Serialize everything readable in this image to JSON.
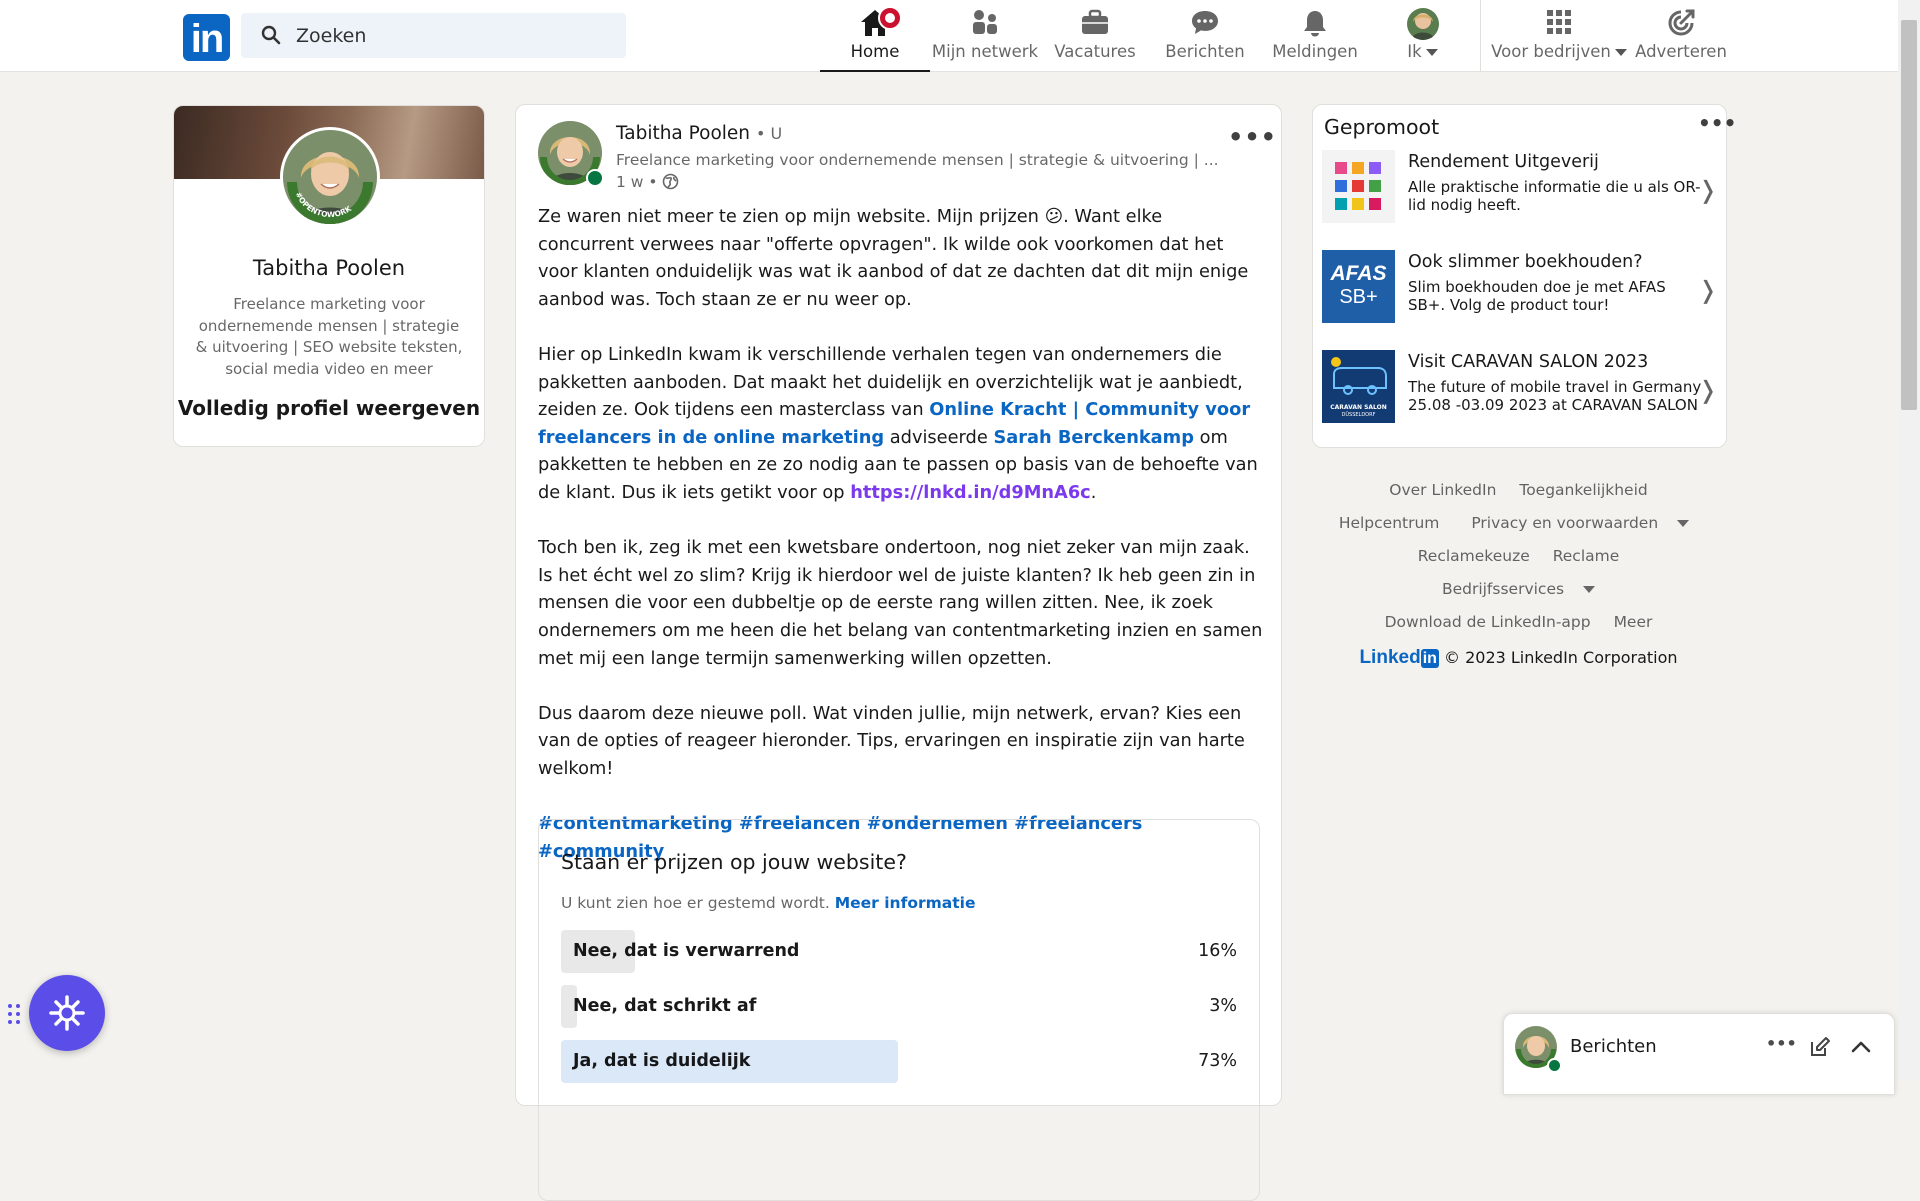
{
  "nav": {
    "search_placeholder": "Zoeken",
    "items": [
      {
        "label": "Home"
      },
      {
        "label": "Mijn netwerk"
      },
      {
        "label": "Vacatures"
      },
      {
        "label": "Berichten"
      },
      {
        "label": "Meldingen"
      },
      {
        "label": "Ik"
      },
      {
        "label": "Voor bedrijven"
      },
      {
        "label": "Adverteren"
      }
    ]
  },
  "profile": {
    "name": "Tabitha Poolen",
    "headline": "Freelance marketing voor ondernemende mensen | strategie & uitvoering | SEO website teksten, social media video en meer",
    "view_full": "Volledig profiel weergeven",
    "frame_text": "#OPENTOWORK"
  },
  "post": {
    "author": "Tabitha Poolen",
    "degree": "• U",
    "headline": "Freelance marketing voor ondernemende mensen | strategie & uitvoering | ...",
    "time": "1 w •",
    "p1": "Ze waren niet meer te zien op mijn website. Mijn prijzen 😕. Want elke concurrent verwees naar \"offerte opvragen\". Ik wilde ook voorkomen dat het voor klanten onduidelijk was wat ik aanbod of dat ze dachten dat dit mijn enige aanbod was. Toch staan ze er nu weer op.",
    "p2_a": "Hier op LinkedIn kwam ik verschillende verhalen tegen van ondernemers die pakketten aanboden. Dat maakt het duidelijk en overzichtelijk wat je aanbiedt, zeiden ze. Ook tijdens een masterclass van ",
    "p2_link1": "Online Kracht | Community voor freelancers in de online marketing",
    "p2_b": " adviseerde ",
    "p2_link2": "Sarah Berckenkamp",
    "p2_c": " om pakketten te hebben en ze zo nodig aan te passen op basis van de behoefte van de klant. Dus ik iets getikt voor op ",
    "p2_url": "https://lnkd.in/d9MnA6c",
    "p2_d": ".",
    "p3": "Toch ben ik, zeg ik met een kwetsbare ondertoon, nog niet zeker van mijn zaak. Is het écht wel zo slim? Krijg ik hierdoor wel de juiste klanten? Ik heb geen zin in mensen die voor een dubbeltje op de eerste rang willen zitten. Nee, ik zoek ondernemers om me heen die het belang van contentmarketing inzien en samen met mij een lange termijn samenwerking willen opzetten.",
    "p4": "Dus daarom deze nieuwe poll. Wat vinden jullie, mijn netwerk, ervan? Kies een van de opties of reageer hieronder. Tips, ervaringen en inspiratie zijn van harte welkom!",
    "hashtags": "#contentmarketing #freelancen #ondernemen #freelancers #community",
    "poll": {
      "question": "Staan er prijzen op jouw website?",
      "note": "U kunt zien hoe er gestemd wordt.",
      "more": "Meer informatie",
      "options": [
        {
          "text": "Nee, dat is verwarrend",
          "pct": "16%",
          "value": 0.16
        },
        {
          "text": "Nee, dat schrikt af",
          "pct": "3%",
          "value": 0.03
        },
        {
          "text": "Ja, dat is duidelijk",
          "pct": "73%",
          "value": 0.73
        }
      ]
    }
  },
  "promo": {
    "title": "Gepromoot",
    "ads": [
      {
        "title": "Rendement Uitgeverij",
        "desc": "Alle praktische informatie die u als OR-lid nodig heeft."
      },
      {
        "title": "Ook slimmer boekhouden?",
        "desc": "Slim boekhouden doe je met AFAS SB+. Volg de product tour!",
        "logo_a": "AFAS",
        "logo_b": "SB+"
      },
      {
        "title": "Visit CARAVAN SALON 2023",
        "desc": "The future of mobile travel in Germany 25.08 -03.09 2023 at CARAVAN SALON",
        "logo_a": "CARAVAN SALON",
        "logo_b": "DÜSSELDORF"
      }
    ]
  },
  "footer": {
    "links": [
      "Over LinkedIn",
      "Toegankelijkheid",
      "Helpcentrum",
      "Privacy en voorwaarden",
      "Reclamekeuze",
      "Reclame",
      "Bedrijfsservices",
      "Download de LinkedIn-app",
      "Meer"
    ],
    "brand_a": "Linked",
    "brand_b": "in",
    "copyright": "© 2023 LinkedIn Corporation"
  },
  "messaging": {
    "title": "Berichten"
  },
  "colors": {
    "brand": "#0a66c2",
    "poll_leader": "#dbe8f8",
    "poll_other": "#e8e8e8"
  }
}
